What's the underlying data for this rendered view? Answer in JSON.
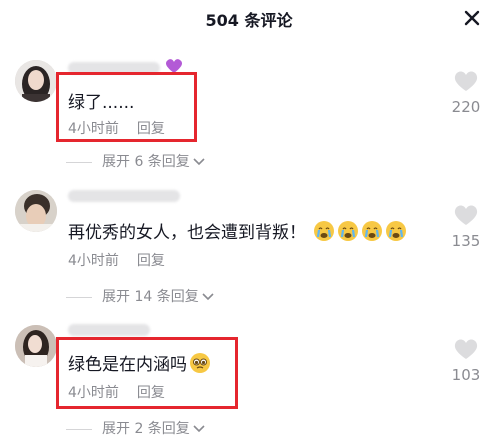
{
  "header": {
    "title": "504 条评论",
    "close_label": "✕"
  },
  "comments": [
    {
      "text": "绿了......",
      "time": "4小时前",
      "reply_label": "回复",
      "likes": "220",
      "expand_label": "展开 6 条回复",
      "highlighted": true
    },
    {
      "text": "再优秀的女人，也会遭到背叛！",
      "emoji": "crying-face x4",
      "time": "4小时前",
      "reply_label": "回复",
      "likes": "135",
      "expand_label": "展开 14 条回复",
      "highlighted": false
    },
    {
      "text": "绿色是在内涵吗",
      "emoji": "pleading-face",
      "time": "4小时前",
      "reply_label": "回复",
      "likes": "103",
      "expand_label": "展开 2 条回复",
      "highlighted": true
    }
  ],
  "colors": {
    "highlight": "#e5262e",
    "muted": "#8a8b91",
    "text": "#161823"
  }
}
